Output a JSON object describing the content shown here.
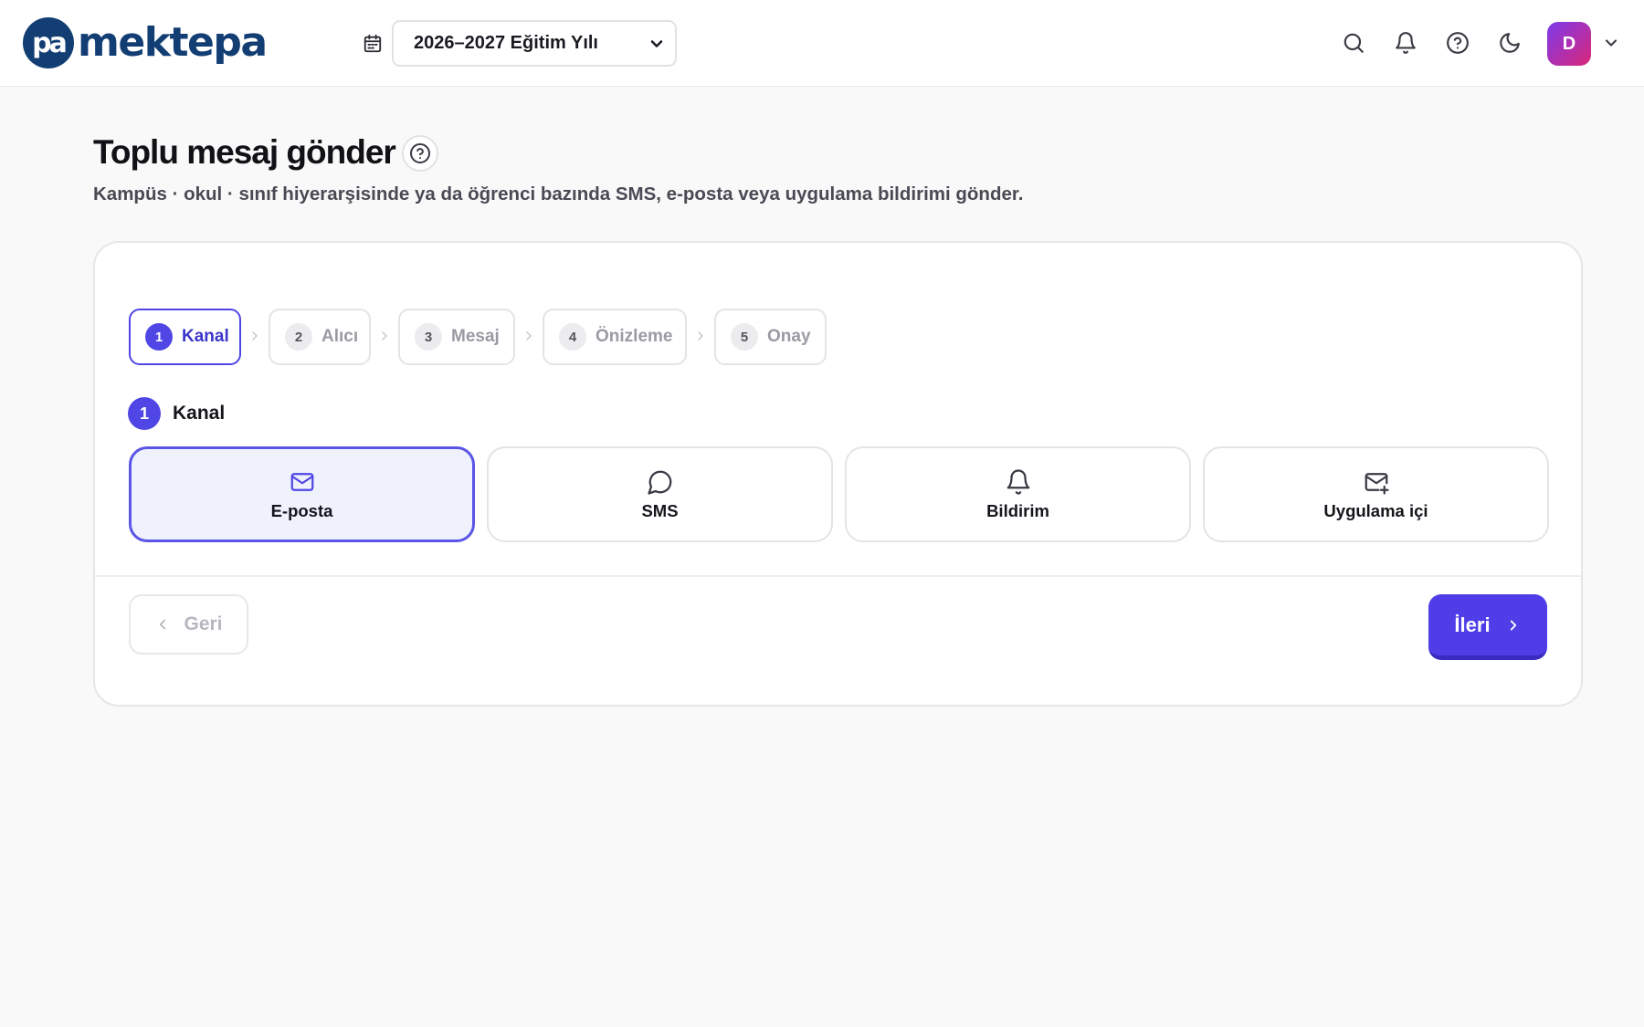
{
  "header": {
    "logo_text": "mektepa",
    "logo_mark": "pa",
    "academic_year": "2026–2027 Eğitim Yılı",
    "avatar_initial": "D",
    "icons": [
      "search-icon",
      "bell-icon",
      "help-icon",
      "moon-icon"
    ]
  },
  "page": {
    "title": "Toplu mesaj gönder",
    "subtitle": "Kampüs · okul · sınıf hiyerarşisinde ya da öğrenci bazında SMS, e-posta veya uygulama bildirimi gönder."
  },
  "stepper": {
    "steps": [
      {
        "num": "1",
        "label": "Kanal",
        "active": true
      },
      {
        "num": "2",
        "label": "Alıcı",
        "active": false
      },
      {
        "num": "3",
        "label": "Mesaj",
        "active": false
      },
      {
        "num": "4",
        "label": "Önizleme",
        "active": false
      },
      {
        "num": "5",
        "label": "Onay",
        "active": false
      }
    ]
  },
  "section": {
    "num": "1",
    "title": "Kanal"
  },
  "channels": [
    {
      "label": "E-posta",
      "icon": "mail-icon",
      "selected": true
    },
    {
      "label": "SMS",
      "icon": "chat-icon",
      "selected": false
    },
    {
      "label": "Bildirim",
      "icon": "bell-icon",
      "selected": false
    },
    {
      "label": "Uygulama içi",
      "icon": "mail-plus-icon",
      "selected": false
    }
  ],
  "footer": {
    "back_label": "Geri",
    "next_label": "İleri"
  },
  "colors": {
    "accent": "#4f46e5",
    "brand": "#123e74",
    "selected_bg": "#eff2fd"
  }
}
